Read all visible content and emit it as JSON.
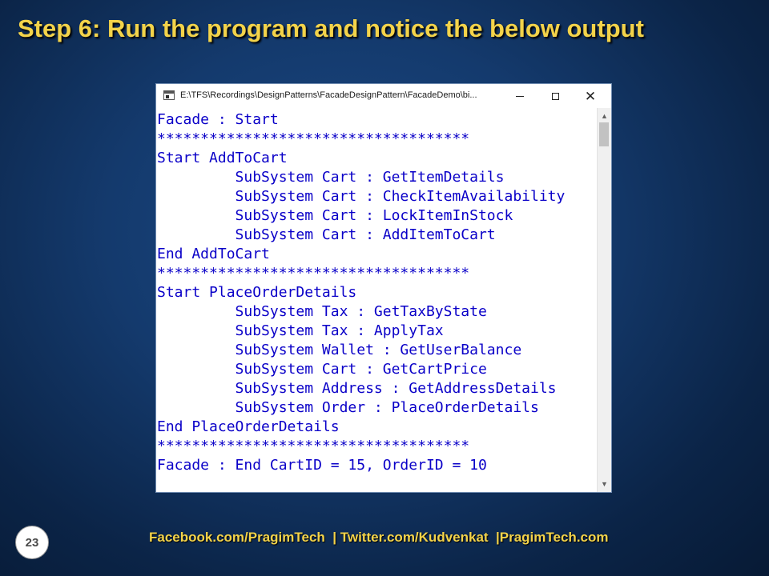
{
  "slide": {
    "title": "Step 6:  Run the program and notice the below output",
    "footer": "Facebook.com/PragimTech  | Twitter.com/Kudvenkat  |PragimTech.com",
    "number": "23"
  },
  "window": {
    "title": "E:\\TFS\\Recordings\\DesignPatterns\\FacadeDesignPattern\\FacadeDemo\\bi...",
    "minimize_glyph": "—",
    "maximize_glyph": "☐",
    "close_glyph": "✕"
  },
  "console": {
    "lines": [
      "Facade : Start",
      "************************************",
      "Start AddToCart",
      "         SubSystem Cart : GetItemDetails",
      "         SubSystem Cart : CheckItemAvailability",
      "         SubSystem Cart : LockItemInStock",
      "         SubSystem Cart : AddItemToCart",
      "End AddToCart",
      "************************************",
      "Start PlaceOrderDetails",
      "         SubSystem Tax : GetTaxByState",
      "         SubSystem Tax : ApplyTax",
      "         SubSystem Wallet : GetUserBalance",
      "         SubSystem Cart : GetCartPrice",
      "         SubSystem Address : GetAddressDetails",
      "         SubSystem Order : PlaceOrderDetails",
      "End PlaceOrderDetails",
      "************************************",
      "Facade : End CartID = 15, OrderID = 10"
    ]
  },
  "colors": {
    "console_text": "#0a00c8",
    "title_text": "#f3d34a",
    "background": "#143a6d"
  }
}
